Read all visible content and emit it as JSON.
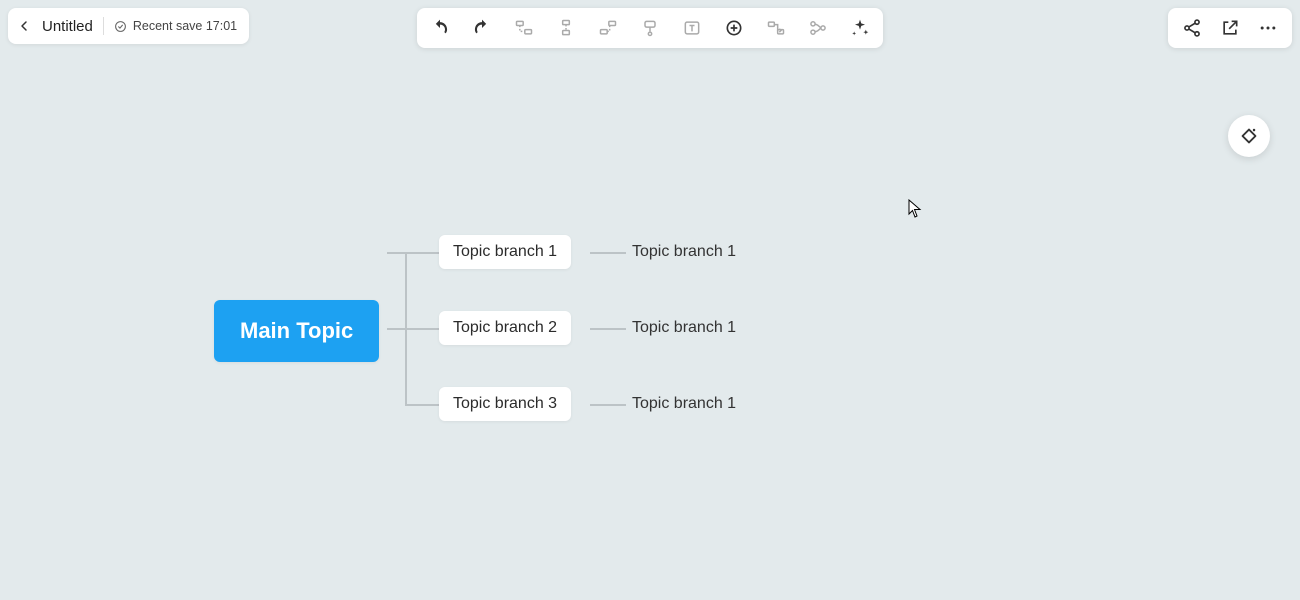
{
  "header": {
    "title": "Untitled",
    "save_status": "Recent save 17:01"
  },
  "mindmap": {
    "root": "Main Topic",
    "branches": [
      {
        "label": "Topic branch 1",
        "leaf": "Topic branch 1"
      },
      {
        "label": "Topic branch 2",
        "leaf": "Topic branch 1"
      },
      {
        "label": "Topic branch 3",
        "leaf": "Topic branch 1"
      }
    ]
  }
}
